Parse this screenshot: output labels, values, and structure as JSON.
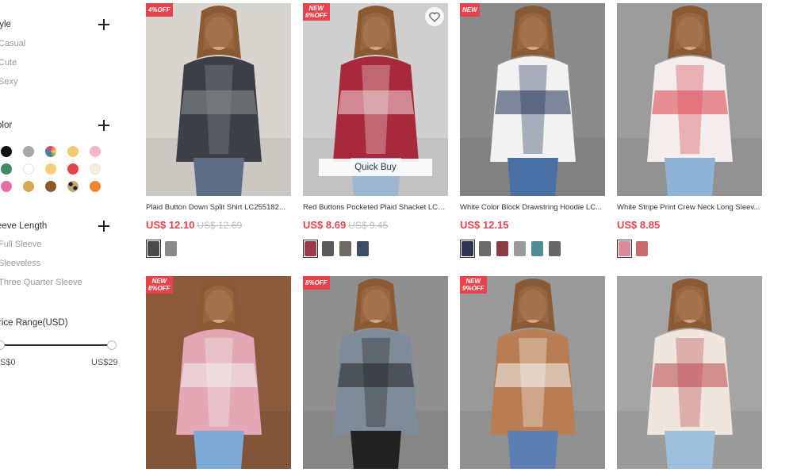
{
  "filters": {
    "style": {
      "title": "tyle",
      "options": [
        "Casual",
        "Cute",
        "Sexy"
      ]
    },
    "color": {
      "title": "olor",
      "swatches": [
        "#111111",
        "#a8a8a8",
        "multi",
        "#f3c86e",
        "#f4b4c4",
        "#3f8a5f",
        "#ffffff",
        "#f5cf73",
        "#e8434c",
        "#f7efdc",
        "#e76ea3",
        "#d4aa52",
        "#8a5a2a",
        "leopard",
        "#ef8732"
      ]
    },
    "sleeve": {
      "title": "eeve Length",
      "options": [
        "Full Sleeve",
        "Sleeveless",
        "Three Quarter Sleeve"
      ]
    },
    "price": {
      "title": "rice Range(USD)",
      "min_label": "S$0",
      "max_label": "US$29"
    }
  },
  "products": [
    {
      "name": "Plaid Button Down Split Shirt LC255182...",
      "price": "US$ 12.10",
      "old_price": "US$ 12.69",
      "badge": [
        "4%OFF"
      ],
      "thumbs": [
        "#4a4a4a",
        "#8a8a8a"
      ],
      "img": {
        "bg": "#d8d4cf",
        "top": "#3c3f46",
        "accent": "#8d8f8f",
        "pants": "#5d6d86"
      }
    },
    {
      "name": "Red Buttons Pocketed Plaid Shacket LC2...",
      "price": "US$ 8.69",
      "old_price": "US$ 9.45",
      "badge": [
        "NEW",
        "8%OFF"
      ],
      "quick_buy": "Quick Buy",
      "thumbs": [
        "#9b3a48",
        "#5a5a5a",
        "#6d6a66",
        "#3e4d66"
      ],
      "img": {
        "bg": "#cfcfcf",
        "top": "#a8293b",
        "accent": "#f1d9dc",
        "pants": "#9cb5d1"
      }
    },
    {
      "name": "White Color Block Drawstring Hoodie LC...",
      "price": "US$ 12.15",
      "old_price": "",
      "badge": [
        "NEW"
      ],
      "thumbs": [
        "#2d3552",
        "#6a6a6a",
        "#8b3b46",
        "#9a9a9a",
        "#4f8f93",
        "#666666"
      ],
      "img": {
        "bg": "#8a8a8a",
        "top": "#f2f2f2",
        "accent": "#1f2d55",
        "pants": "#4a6fa5"
      }
    },
    {
      "name": "White Stripe Print Crew Neck Long Sleev...",
      "price": "US$ 8.85",
      "old_price": "",
      "badge": [],
      "thumbs": [
        "#d98a9a",
        "#c96b6b"
      ],
      "img": {
        "bg": "#9c9c9c",
        "top": "#f3eded",
        "accent": "#d9414d",
        "pants": "#8fb3d6"
      }
    },
    {
      "name": "",
      "price": "",
      "old_price": "",
      "badge": [
        "NEW",
        "8%OFF"
      ],
      "thumbs": [],
      "img": {
        "bg": "#8b5a3c",
        "top": "#e4a7b5",
        "accent": "#f3f3f3",
        "pants": "#7eaad7"
      }
    },
    {
      "name": "",
      "price": "",
      "old_price": "",
      "badge": [
        "8%OFF"
      ],
      "thumbs": [],
      "img": {
        "bg": "#8f8f8f",
        "top": "#7e8c9a",
        "accent": "#222222",
        "pants": "#222222"
      }
    },
    {
      "name": "",
      "price": "",
      "old_price": "",
      "badge": [
        "NEW",
        "9%OFF"
      ],
      "thumbs": [],
      "img": {
        "bg": "#9a9a9a",
        "top": "#b87d52",
        "accent": "#f5f5f5",
        "pants": "#5c7fb3"
      }
    },
    {
      "name": "",
      "price": "",
      "old_price": "",
      "badge": [],
      "thumbs": [],
      "img": {
        "bg": "#a5a5a5",
        "top": "#f1e6dd",
        "accent": "#b8474f",
        "pants": "#9fc0dc"
      }
    }
  ]
}
